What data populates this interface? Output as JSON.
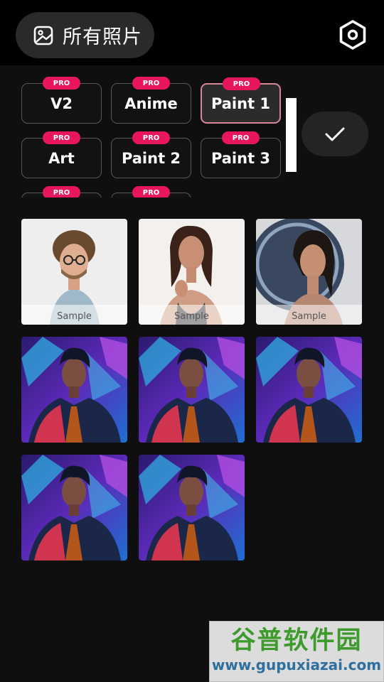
{
  "header": {
    "album_label": "所有照片",
    "gallery_icon": "gallery-icon",
    "settings_icon": "settings-hexagon-icon"
  },
  "styles": [
    {
      "name": "V2",
      "badge": "PRO",
      "selected": false
    },
    {
      "name": "Anime",
      "badge": "PRO",
      "selected": false
    },
    {
      "name": "Paint 1",
      "badge": "PRO",
      "selected": true
    },
    {
      "name": "Art",
      "badge": "PRO",
      "selected": false
    },
    {
      "name": "Paint 2",
      "badge": "PRO",
      "selected": false
    },
    {
      "name": "Paint 3",
      "badge": "PRO",
      "selected": false
    },
    {
      "name": "",
      "badge": "PRO",
      "selected": false
    },
    {
      "name": "",
      "badge": "PRO",
      "selected": false
    }
  ],
  "confirm_icon": "checkmark-icon",
  "photos": [
    {
      "kind": "sample-man-curly-hair",
      "label": "Sample"
    },
    {
      "kind": "sample-woman-dark-hair",
      "label": "Sample"
    },
    {
      "kind": "sample-woman-ring-light",
      "label": "Sample"
    },
    {
      "kind": "user-photo-man-neon",
      "label": ""
    },
    {
      "kind": "user-photo-man-neon",
      "label": ""
    },
    {
      "kind": "user-photo-man-neon",
      "label": ""
    },
    {
      "kind": "user-photo-man-neon",
      "label": ""
    },
    {
      "kind": "user-photo-man-neon",
      "label": ""
    }
  ],
  "watermark": {
    "title": "谷普软件园",
    "url": "www.gupuxiazai.com"
  },
  "colors": {
    "pro_badge": "#e8175d",
    "selected_border": "#d88596",
    "watermark_green": "#3f9a2e"
  }
}
